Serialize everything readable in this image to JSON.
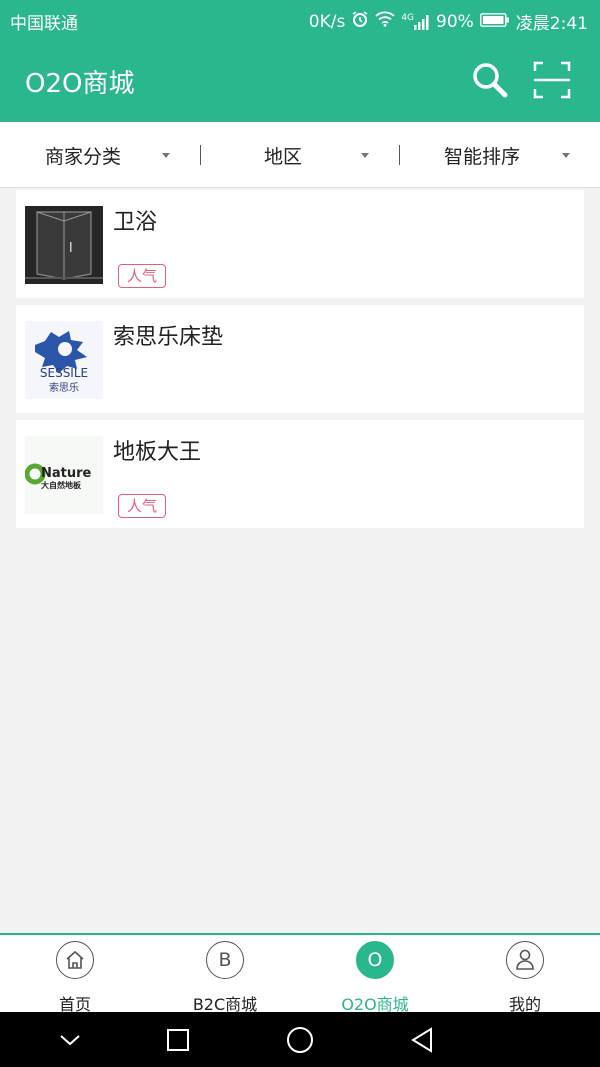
{
  "status_bar": {
    "carrier": "中国联通",
    "network_speed": "0K/s",
    "signal_type": "4G",
    "battery": "90%",
    "time": "凌晨2:41",
    "icons": [
      "alarm-icon",
      "wifi-icon",
      "signal-icon",
      "battery-icon"
    ]
  },
  "app_bar": {
    "title": "O2O商城",
    "icons": [
      "search-icon",
      "scan-icon"
    ]
  },
  "filters": [
    {
      "label": "商家分类"
    },
    {
      "label": "地区"
    },
    {
      "label": "智能排序"
    }
  ],
  "stores": [
    {
      "name": "卫浴",
      "tag": "人气",
      "thumb": "shower-enclosure"
    },
    {
      "name": "索思乐床垫",
      "tag": "",
      "thumb": "sessile-logo",
      "logo_text": "SESSILE",
      "logo_subtext": "索思乐"
    },
    {
      "name": "地板大王",
      "tag": "人气",
      "thumb": "nature-logo",
      "logo_text": "Nature",
      "logo_subtext": "大自然地板"
    }
  ],
  "tabs": [
    {
      "label": "首页",
      "icon": "home-icon",
      "glyph": "",
      "active": false
    },
    {
      "label": "B2C商城",
      "icon": "b-icon",
      "glyph": "B",
      "active": false
    },
    {
      "label": "O2O商城",
      "icon": "o-icon",
      "glyph": "O",
      "active": true
    },
    {
      "label": "我的",
      "icon": "user-icon",
      "glyph": "",
      "active": false
    }
  ],
  "colors": {
    "primary": "#2bb78e",
    "tag": "#e2607a",
    "background": "#f2f2f2"
  },
  "android_nav": [
    "back-chevron-icon",
    "recents-icon",
    "home-circle-icon",
    "back-triangle-icon"
  ]
}
